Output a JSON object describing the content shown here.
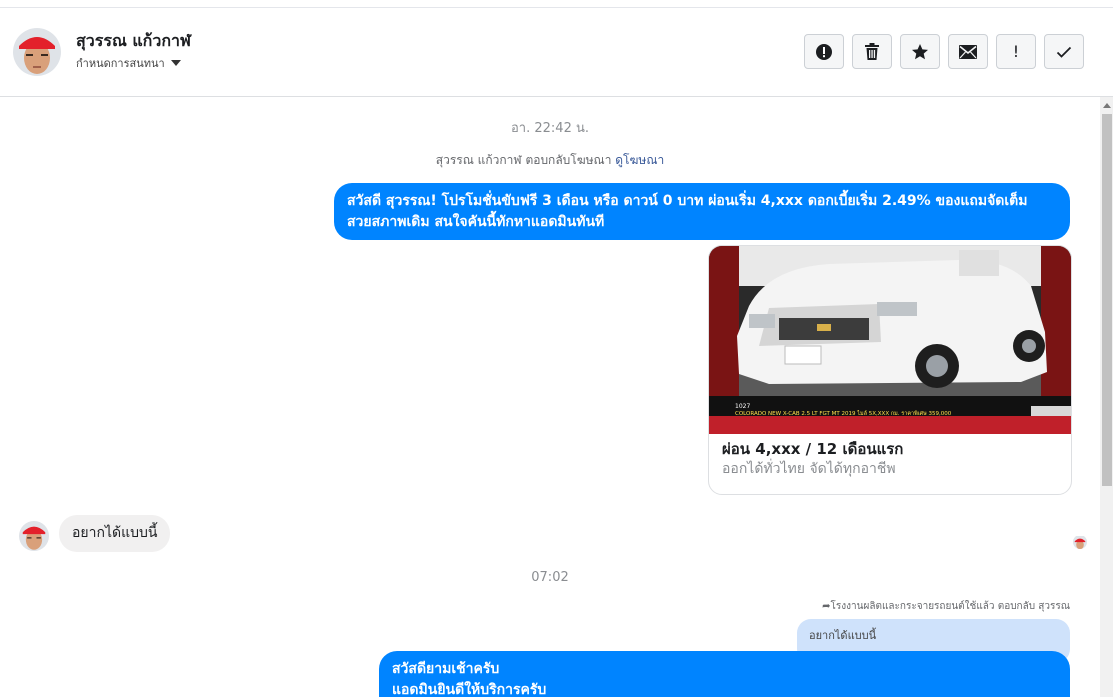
{
  "header": {
    "contact_name": "สุวรรณ แก้วกาฬ",
    "assign_label": "กำหนดการสนทนา"
  },
  "toolbar": {
    "buttons": [
      {
        "icon": "alert-circle-icon"
      },
      {
        "icon": "trash-icon"
      },
      {
        "icon": "star-icon"
      },
      {
        "icon": "envelope-icon"
      },
      {
        "icon": "exclamation-icon",
        "label": "!"
      },
      {
        "icon": "checkmark-icon"
      }
    ]
  },
  "conversation": {
    "timestamp_1": "อา. 22:42 น.",
    "ad_reply_prefix": "สุวรรณ แก้วกาฬ ตอบกลับโฆษณา",
    "ad_reply_link": "ดูโฆษณา",
    "outgoing_1_line1": "สวัสดี สุวรรณ! โปรโมชั่นขับฟรี 3 เดือน หรือ ดาวน์ 0 บาท ผ่อนเริ่ม 4,xxx ดอกเบี้ยเริ่ม 2.49% ของแถมจัดเต็ม",
    "outgoing_1_line2": "สวยสภาพเดิม สนใจคันนี้ทักหาแอดมินทันที",
    "ad_card": {
      "title": "ผ่อน 4,xxx / 12 เดือนแรก",
      "subtitle": "ออกได้ทั่วไทย จัดได้ทุกอาชีพ",
      "image_banner": "COLORADO NEW X-CAB 2.5 LT FGT MT 2019 ไมล์ 5X,XXX กม. ราคาพิเศษ 359,000",
      "image_badge": "1027"
    },
    "incoming_1": "อยากได้แบบนี้",
    "timestamp_2": "07:02",
    "reply_reference": "โรงงานผลิตและกระจายรถยนต์ใช้แล้ว ตอบกลับ สุวรรณ",
    "quoted_message": "อยากได้แบบนี้",
    "outgoing_2_line1": "สวัสดียามเช้าครับ",
    "outgoing_2_line2": "แอดมินยินดีให้บริการครับ"
  },
  "colors": {
    "accent": "#0084ff",
    "incoming_bubble": "#f1f0f0",
    "quoted_bubble": "#cfe2fb",
    "link": "#385898"
  }
}
